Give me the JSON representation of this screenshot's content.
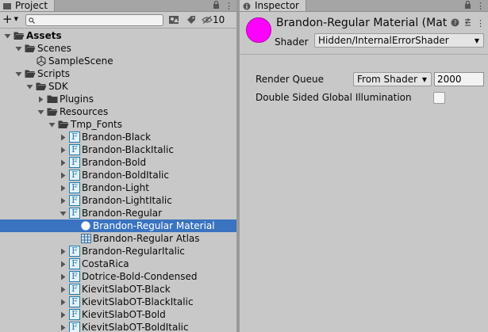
{
  "project": {
    "tab_label": "Project",
    "search_placeholder": "",
    "hidden_count": "10",
    "tree": [
      {
        "label": "Assets",
        "level": 0,
        "arrow": "open",
        "icon": "folder-open",
        "bold": true
      },
      {
        "label": "Scenes",
        "level": 1,
        "arrow": "open",
        "icon": "folder-open"
      },
      {
        "label": "SampleScene",
        "level": 2,
        "arrow": "none",
        "icon": "unity-scene"
      },
      {
        "label": "Scripts",
        "level": 1,
        "arrow": "open",
        "icon": "folder-open"
      },
      {
        "label": "SDK",
        "level": 2,
        "arrow": "open",
        "icon": "folder-open"
      },
      {
        "label": "Plugins",
        "level": 3,
        "arrow": "closed",
        "icon": "folder"
      },
      {
        "label": "Resources",
        "level": 3,
        "arrow": "open",
        "icon": "folder-open"
      },
      {
        "label": "Tmp_Fonts",
        "level": 4,
        "arrow": "open",
        "icon": "folder-open"
      },
      {
        "label": "Brandon-Black",
        "level": 5,
        "arrow": "closed",
        "icon": "font"
      },
      {
        "label": "Brandon-BlackItalic",
        "level": 5,
        "arrow": "closed",
        "icon": "font"
      },
      {
        "label": "Brandon-Bold",
        "level": 5,
        "arrow": "closed",
        "icon": "font"
      },
      {
        "label": "Brandon-BoldItalic",
        "level": 5,
        "arrow": "closed",
        "icon": "font"
      },
      {
        "label": "Brandon-Light",
        "level": 5,
        "arrow": "closed",
        "icon": "font"
      },
      {
        "label": "Brandon-LightItalic",
        "level": 5,
        "arrow": "closed",
        "icon": "font"
      },
      {
        "label": "Brandon-Regular",
        "level": 5,
        "arrow": "open",
        "icon": "font"
      },
      {
        "label": "Brandon-Regular Material",
        "level": 6,
        "arrow": "none",
        "icon": "material",
        "selected": true
      },
      {
        "label": "Brandon-Regular Atlas",
        "level": 6,
        "arrow": "none",
        "icon": "texture"
      },
      {
        "label": "Brandon-RegularItalic",
        "level": 5,
        "arrow": "closed",
        "icon": "font"
      },
      {
        "label": "CostaRica",
        "level": 5,
        "arrow": "closed",
        "icon": "font"
      },
      {
        "label": "Dotrice-Bold-Condensed",
        "level": 5,
        "arrow": "closed",
        "icon": "font"
      },
      {
        "label": "KievitSlabOT-Black",
        "level": 5,
        "arrow": "closed",
        "icon": "font"
      },
      {
        "label": "KievitSlabOT-BlackItalic",
        "level": 5,
        "arrow": "closed",
        "icon": "font"
      },
      {
        "label": "KievitSlabOT-Bold",
        "level": 5,
        "arrow": "closed",
        "icon": "font"
      },
      {
        "label": "KievitSlabOT-BoldItalic",
        "level": 5,
        "arrow": "closed",
        "icon": "font"
      }
    ]
  },
  "inspector": {
    "tab_label": "Inspector",
    "material_title": "Brandon-Regular Material (Materia",
    "material_color": "#ff00ff",
    "shader_label": "Shader",
    "shader_value": "Hidden/InternalErrorShader",
    "render_queue_label": "Render Queue",
    "render_queue_mode": "From Shader",
    "render_queue_value": "2000",
    "dsgi_label": "Double Sided Global Illumination",
    "dsgi_checked": false
  },
  "colors": {
    "selection": "#3a73c0",
    "font_icon": "#1e7bb0"
  }
}
